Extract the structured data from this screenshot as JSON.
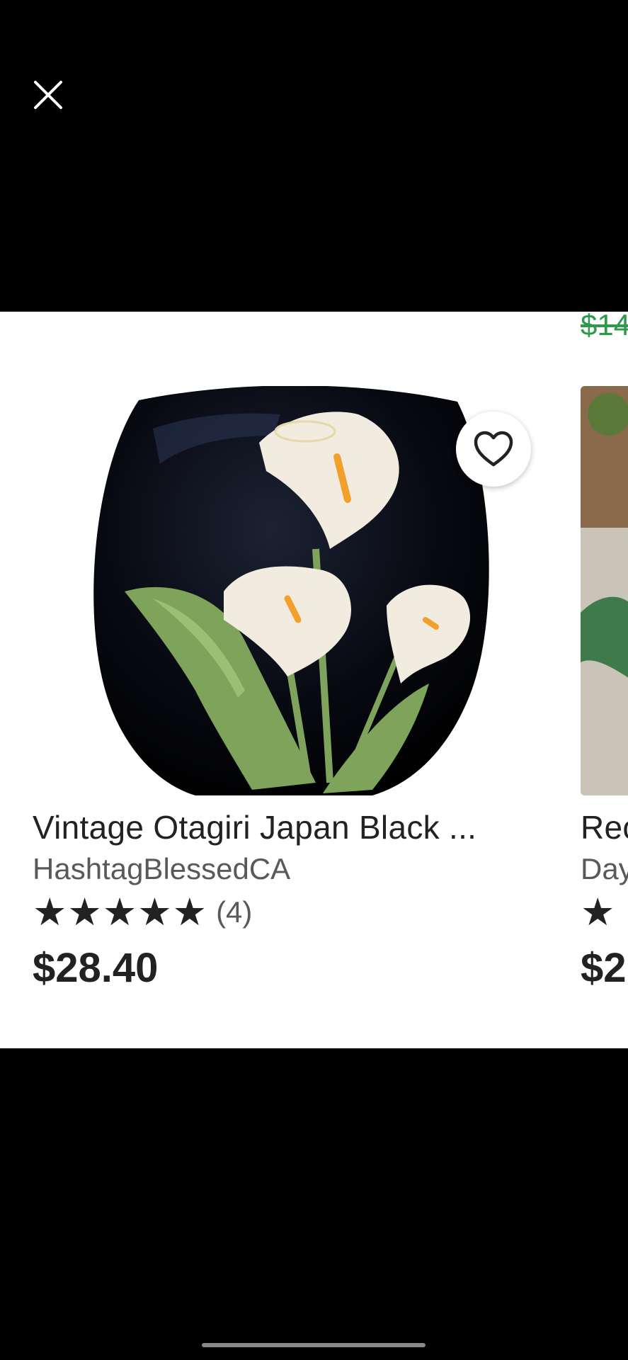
{
  "viewer": {
    "close_icon": "close-icon"
  },
  "previous_row": {
    "clipped_price": "$14"
  },
  "listing": {
    "title": "Vintage Otagiri Japan Black ...",
    "shop": "HashtagBlessedCA",
    "rating_stars": "★★★★★",
    "rating_value": 5,
    "review_count": "(4)",
    "price": "$28.40",
    "favorite_icon": "heart-outline-icon",
    "image_subject": "black vase with calla lilies"
  },
  "next_listing": {
    "title": "Rec",
    "shop": "Day",
    "rating_stars": "★",
    "price": "$2"
  },
  "colors": {
    "background": "#000000",
    "panel": "#ffffff",
    "text_primary": "#222222",
    "text_secondary": "#595959",
    "sale_price": "#2f9a4b"
  }
}
